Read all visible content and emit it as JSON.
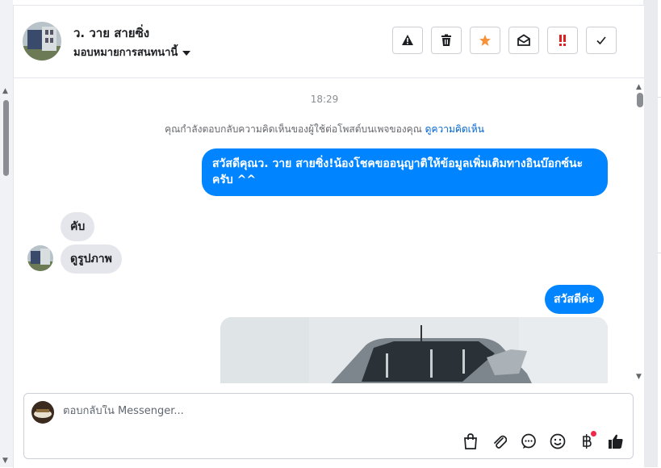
{
  "header": {
    "contact_name": "ว. วาย สายซิ่ง",
    "assign_label": "มอบหมายการสนทนานี้"
  },
  "chat": {
    "timestamp": "18:29",
    "notice_text": "คุณกำลังตอบกลับความคิดเห็นของผู้ใช้ต่อโพสต์บนเพจของคุณ ",
    "notice_link": "ดูความคิดเห็น",
    "messages": [
      {
        "direction": "outgoing",
        "text": "สวัสดีคุณว. วาย สายซิ่ง!น้องโชคขออนุญาติให้ข้อมูลเพิ่มเติมทางอินบ๊อกซ์นะครับ ^^"
      },
      {
        "direction": "incoming",
        "text": "คับ"
      },
      {
        "direction": "incoming",
        "text": "ดูรูปภาพ"
      },
      {
        "direction": "outgoing",
        "text": "สวัสดีค่ะ"
      }
    ]
  },
  "composer": {
    "placeholder": "ตอบกลับใน Messenger..."
  },
  "colors": {
    "accent_blue": "#0084ff",
    "star_orange": "#f7923a",
    "alert_red": "#e02020"
  }
}
